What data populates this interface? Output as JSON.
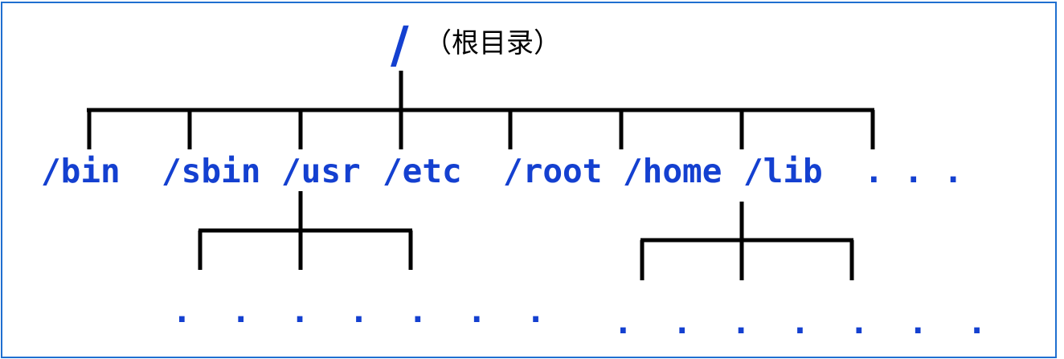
{
  "colors": {
    "label": "#1440d0",
    "line": "#000000",
    "border": "#1f6fd0"
  },
  "root": {
    "symbol": "/",
    "caption": "（根目录）"
  },
  "directories": [
    {
      "name": "/bin"
    },
    {
      "name": "/sbin"
    },
    {
      "name": "/usr"
    },
    {
      "name": "/etc"
    },
    {
      "name": "/root"
    },
    {
      "name": "/home"
    },
    {
      "name": "/lib"
    },
    {
      "name": ". . ."
    }
  ],
  "subtrees": {
    "usr_children": ". . . . . . .",
    "lib_children": ". . . . . . ."
  }
}
